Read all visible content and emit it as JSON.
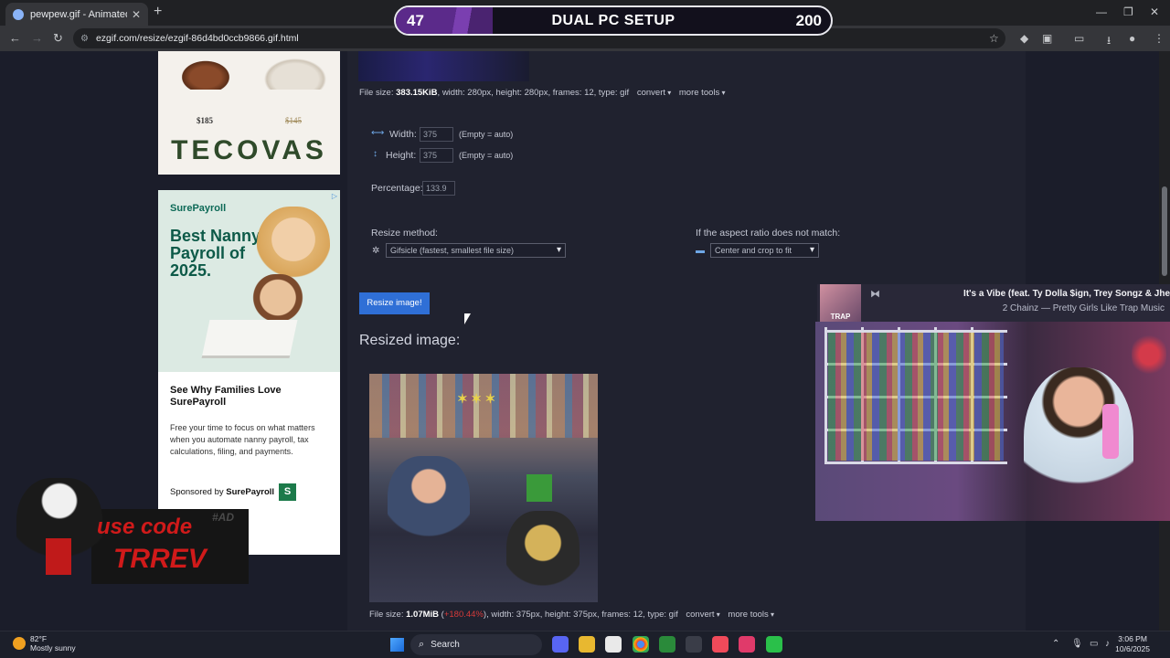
{
  "browser": {
    "tab_title": "pewpew.gif - Animated image",
    "url": "ezgif.com/resize/ezgif-86d4bd0ccb9866.gif.html"
  },
  "overlay": {
    "count_left": "47",
    "label": "DUAL PC SETUP",
    "count_right": "200"
  },
  "ads": {
    "tecovas": {
      "price_boots": "$185",
      "price_hat": "$145",
      "brand": "TECOVAS"
    },
    "surepayroll": {
      "logo": "SurePayroll",
      "headline": "Best Nanny Payroll of 2025.",
      "title": "See Why Families Love SurePayroll",
      "body": "Free your time to focus on what matters when you automate nanny payroll, tax calculations, filing, and payments.",
      "sponsored_prefix": "Sponsored by",
      "sponsored_name": "SurePayroll"
    }
  },
  "source_info": {
    "prefix": "File size:",
    "size": "383.15KiB",
    "rest": ", width: 280px, height: 280px, frames: 12, type: gif",
    "convert": "convert",
    "more_tools": "more tools"
  },
  "form": {
    "width_label": "Width:",
    "width_value": "375",
    "width_hint": "(Empty = auto)",
    "height_label": "Height:",
    "height_value": "375",
    "height_hint": "(Empty = auto)",
    "percentage_label": "Percentage:",
    "percentage_value": "133.9",
    "resize_method_label": "Resize method:",
    "resize_method_value": "Gifsicle (fastest, smallest file size)",
    "aspect_label": "If the aspect ratio does not match:",
    "aspect_value": "Center and crop to fit",
    "submit": "Resize image!"
  },
  "result": {
    "heading": "Resized image:",
    "prefix": "File size:",
    "size": "1.07MiB",
    "paren_open": " (",
    "change": "+180.44%",
    "rest": "), width: 375px, height: 375px, frames: 12, type: gif",
    "convert": "convert",
    "more_tools": "more tools"
  },
  "music": {
    "art_label": "TRAP",
    "song": "It's a Vibe (feat. Ty Dolla $ign, Trey Songz & Jhe",
    "artist": "2 Chainz — Pretty Girls Like Trap Music"
  },
  "promo": {
    "line1": "use code",
    "line2": "TRREV",
    "tag": "#AD"
  },
  "taskbar": {
    "temp": "82°F",
    "weather": "Mostly sunny",
    "search": "Search",
    "time": "3:06 PM",
    "date": "10/6/2025"
  }
}
